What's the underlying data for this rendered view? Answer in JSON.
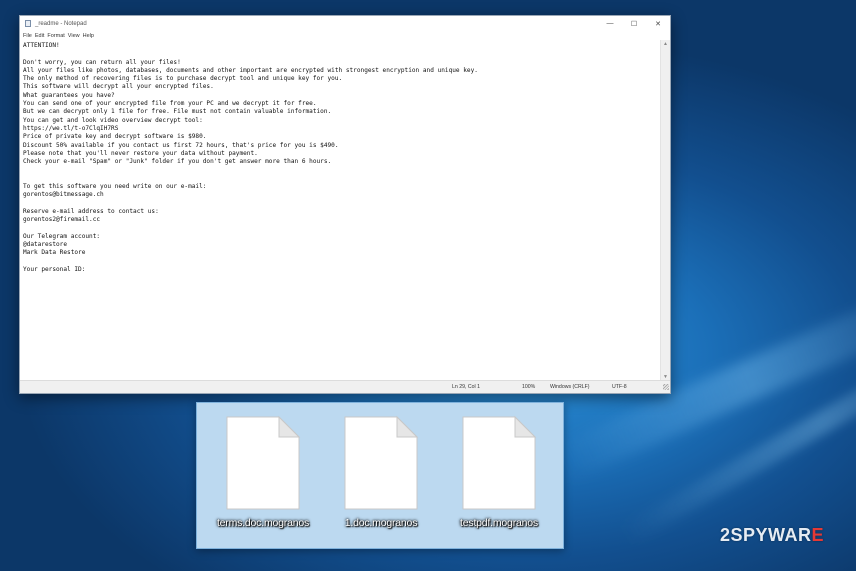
{
  "window": {
    "title": "_readme - Notepad",
    "controls": {
      "minimize": "—",
      "maximize": "☐",
      "close": "✕"
    }
  },
  "menu": [
    "File",
    "Edit",
    "Format",
    "View",
    "Help"
  ],
  "document_text": "ATTENTION!\n\nDon't worry, you can return all your files!\nAll your files like photos, databases, documents and other important are encrypted with strongest encryption and unique key.\nThe only method of recovering files is to purchase decrypt tool and unique key for you.\nThis software will decrypt all your encrypted files.\nWhat guarantees you have?\nYou can send one of your encrypted file from your PC and we decrypt it for free.\nBut we can decrypt only 1 file for free. File must not contain valuable information.\nYou can get and look video overview decrypt tool:\nhttps://we.tl/t-o7ClqIH7RS\nPrice of private key and decrypt software is $980.\nDiscount 50% available if you contact us first 72 hours, that's price for you is $490.\nPlease note that you'll never restore your data without payment.\nCheck your e-mail \"Spam\" or \"Junk\" folder if you don't get answer more than 6 hours.\n\n\nTo get this software you need write on our e-mail:\ngorentos@bitmessage.ch\n\nReserve e-mail address to contact us:\ngorentos2@firemail.cc\n\nOur Telegram account:\n@datarestore\nMark Data Restore\n\nYour personal ID:",
  "status": {
    "position": "Ln 29, Col 1",
    "zoom": "100%",
    "line_ending": "Windows (CRLF)",
    "encoding": "UTF-8"
  },
  "files": [
    {
      "name": "terms.doc.mogranos",
      "icon": "blank-file-icon"
    },
    {
      "name": "1.doc.mogranos",
      "icon": "blank-file-icon"
    },
    {
      "name": "testpdf.mogranos",
      "icon": "blank-file-icon"
    }
  ],
  "watermark": {
    "prefix": "2",
    "middle": "SPYWAR",
    "suffix": "E"
  }
}
